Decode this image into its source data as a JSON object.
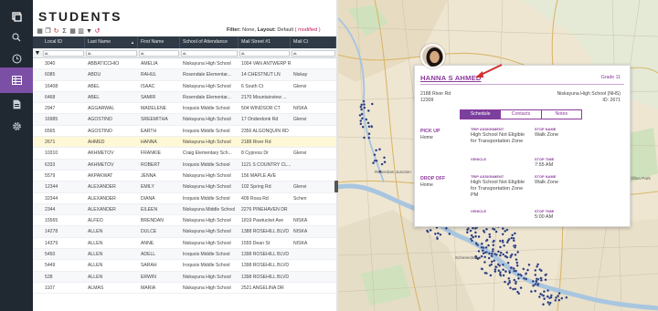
{
  "page": {
    "title": "STUDENTS"
  },
  "nav": [
    {
      "name": "apps-icon"
    },
    {
      "name": "search-icon"
    },
    {
      "name": "history-icon"
    },
    {
      "name": "grid-icon"
    },
    {
      "name": "report-icon"
    },
    {
      "name": "settings-icon"
    }
  ],
  "toolbar": {
    "icons": [
      "table-icon",
      "copy-icon",
      "refresh-icon",
      "sum-icon",
      "grid-icon",
      "columns-icon",
      "filter-icon",
      "reset-icon"
    ],
    "filter_label": "Filter:",
    "filter_value": "None,",
    "layout_label": "Layout:",
    "layout_value": "Default",
    "modified": "( modified )"
  },
  "table": {
    "columns": [
      "Local ID",
      "Last Name",
      "First Name",
      "School of Attendance",
      "Mail Street #1",
      "Mail Ci"
    ],
    "sorted_column": 1,
    "filter_placeholder": "ᴀʟ",
    "rows": [
      [
        "3040",
        "ABBATICCHIO",
        "AMELIA",
        "Niskayuna High School",
        "1004 VAN ANTWERP RD",
        ""
      ],
      [
        "6085",
        "ABDU",
        "RAHUL",
        "Rosendale Elementar...",
        "14 CHESTNUT LN",
        "Niskay"
      ],
      [
        "16408",
        "ABEL",
        "ISAAC",
        "Niskayuna High School",
        "6 South Ct",
        "Glenvi"
      ],
      [
        "6468",
        "ABEL",
        "SAMIR",
        "Rosendale Elementar...",
        "2170 Mountainview ...",
        ""
      ],
      [
        "2947",
        "AGGARWAL",
        "MADELENE",
        "Iroquois Middle School",
        "504 WINDSOR CT",
        "NISKA"
      ],
      [
        "16985",
        "AGOSTINO",
        "SREEMITHA",
        "Niskayuna High School",
        "17 Onderdonk Rd",
        "Glenvi"
      ],
      [
        "6565",
        "AGOSTINO",
        "EARTH",
        "Iroquois Middle School",
        "2356 ALGONQUIN RD",
        ""
      ],
      [
        "2671",
        "AHMED",
        "HANNA",
        "Niskayuna High School",
        "2188 River Rd",
        ""
      ],
      [
        "10310",
        "AKHMETOV",
        "FRANKIE",
        "Craig Elementary Sch...",
        "8 Cypress Dr",
        "Glenvi"
      ],
      [
        "6333",
        "AKHMETOV",
        "ROBERT",
        "Iroquois Middle School",
        "1121 S COUNTRY CL...",
        ""
      ],
      [
        "5579",
        "AKPAKWAT",
        "JENNA",
        "Niskayuna High School",
        "156 MAPLE AVE",
        ""
      ],
      [
        "12344",
        "ALEXANDER",
        "EMILY",
        "Niskayuna High School",
        "102 Spring Rd",
        "Glenvi"
      ],
      [
        "32344",
        "ALEXANDER",
        "DIANA",
        "Iroquois Middle School",
        "409 Rosa Rd",
        "Schen"
      ],
      [
        "2344",
        "ALEXANDER",
        "EILEEN",
        "Niskayuna Middle School",
        "2276 PINEHAVEN DR",
        ""
      ],
      [
        "15565",
        "ALFEO",
        "BRENDAN",
        "Niskayuna High School",
        "1819 Pawtucket Ave",
        "NISKA"
      ],
      [
        "14278",
        "ALLEN",
        "DULCE",
        "Niskayuna High School",
        "1388 ROSEHILL BLVD",
        "NISKA"
      ],
      [
        "14379",
        "ALLEN",
        "ANNE",
        "Niskayuna High School",
        "1555 Dean St",
        "NISKA"
      ],
      [
        "5450",
        "ALLEN",
        "ADELL",
        "Iroquois Middle School",
        "1398 ROSEHILL BLVD",
        ""
      ],
      [
        "5449",
        "ALLEN",
        "SARAH",
        "Iroquois Middle School",
        "1398 ROSEHILL BLVD",
        ""
      ],
      [
        "528",
        "ALLEN",
        "ERWIN",
        "Niskayuna High School",
        "1398 ROSEHILL BLVD",
        ""
      ],
      [
        "1107",
        "ALMAS",
        "MARIA",
        "Niskayuna High School",
        "2521 ANGELINA DR",
        ""
      ]
    ]
  },
  "map": {
    "labels": [
      "Rotterdam Junction",
      "Clifton Park",
      "Schenectady"
    ]
  },
  "popup": {
    "name": "HANNA S AHMED",
    "grade": "Grade 11",
    "address_line1": "2188 River Rd",
    "address_line2": "12309",
    "school": "Niskayuna High School (NHS)",
    "id": "ID: 2671",
    "tabs": [
      "Schedule",
      "Contacts",
      "Notes"
    ],
    "pickup": {
      "title": "PICK UP",
      "location": "Home",
      "trip_label": "TRIP ASSIGNMENT",
      "trip_value": "High School Not Eligible for Transportation Zone",
      "stop_label": "STOP NAME",
      "stop_value": "Walk Zone",
      "vehicle_label": "VEHICLE",
      "time_label": "STOP TIME",
      "time_value": "7:55 AM"
    },
    "dropoff": {
      "title": "DROP OFF",
      "location": "Home",
      "trip_label": "TRIP ASSIGNMENT",
      "trip_value": "High School Not Eligible for Transportation Zone PM",
      "stop_label": "STOP NAME",
      "stop_value": "Walk Zone",
      "vehicle_label": "VEHICLE",
      "time_label": "STOP TIME",
      "time_value": "5:00 AM"
    }
  },
  "colors": {
    "accent": "#7b3f9e",
    "nav_bg": "#202832",
    "header_bg": "#2f3a46",
    "highlight_row": "#fff8d6",
    "map_water": "#a9c6e0",
    "map_dots": "#1f2f6e",
    "arrow": "#d32f2f"
  }
}
